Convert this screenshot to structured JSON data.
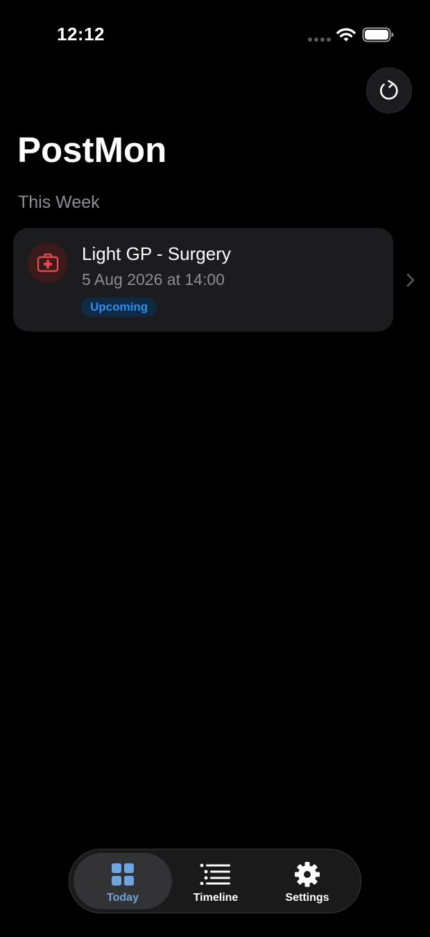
{
  "status_bar": {
    "time": "12:12"
  },
  "header": {
    "title": "PostMon",
    "refresh_icon": "refresh-icon"
  },
  "section": {
    "label": "This Week"
  },
  "appointments": [
    {
      "title": "Light GP - Surgery",
      "datetime": "5 Aug 2026 at 14:00",
      "status": "Upcoming",
      "icon": "medical-kit-icon",
      "icon_color": "#e5484d",
      "status_color": "#2f8ff0"
    }
  ],
  "tab_bar": {
    "active": "Today",
    "tabs": [
      {
        "label": "Today",
        "icon": "grid-icon"
      },
      {
        "label": "Timeline",
        "icon": "list-icon"
      },
      {
        "label": "Settings",
        "icon": "gear-icon"
      }
    ]
  },
  "colors": {
    "background": "#000000",
    "card": "#1c1c1e",
    "accent": "#6fa5e0",
    "secondary_text": "#8e8e93"
  }
}
